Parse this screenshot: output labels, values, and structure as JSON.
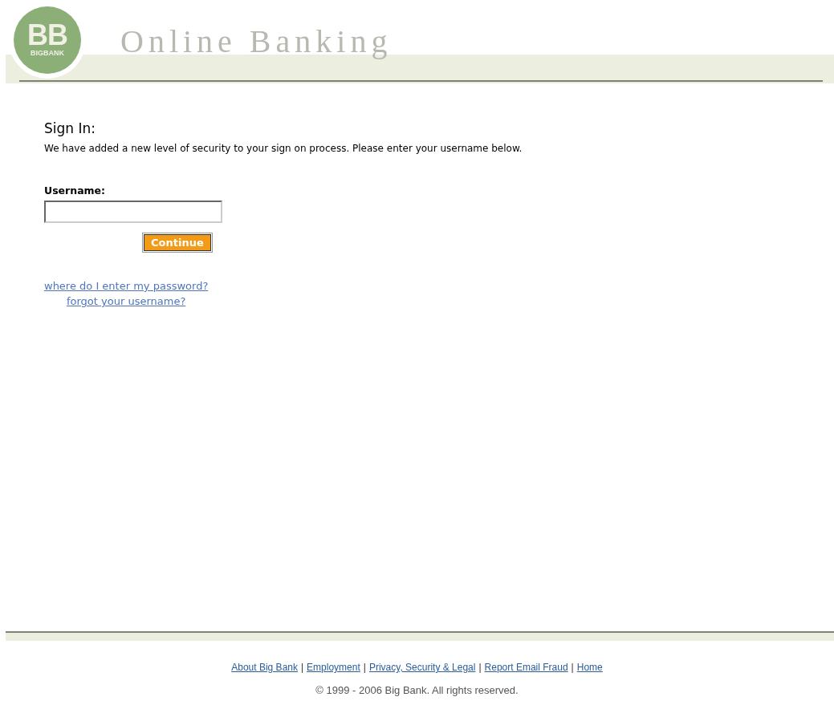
{
  "header": {
    "logo": {
      "initials": "BB",
      "name": "BIGBANK"
    },
    "title": "Online Banking"
  },
  "sign_in": {
    "heading": "Sign In:",
    "intro": "We have added a new level of security to your sign on process. Please enter your username below.",
    "username_label": "Username:",
    "button": "Continue",
    "links": [
      "where do I enter my password?",
      "forgot your username?"
    ]
  },
  "footer": {
    "items": [
      {
        "kind": "link",
        "text": "About Big Bank"
      },
      {
        "kind": "separator",
        "text": "|"
      },
      {
        "kind": "link",
        "text": "Employment"
      },
      {
        "kind": "separator",
        "text": "|"
      },
      {
        "kind": "link",
        "text": "Privacy, Security & Legal"
      },
      {
        "kind": "separator",
        "text": "|"
      },
      {
        "kind": "link",
        "text": "Report Email Fraud"
      },
      {
        "kind": "separator",
        "text": "|"
      },
      {
        "kind": "link",
        "text": "Home"
      }
    ],
    "copyright": "© 1999 - 2006 Big Bank. All rights reserved."
  }
}
